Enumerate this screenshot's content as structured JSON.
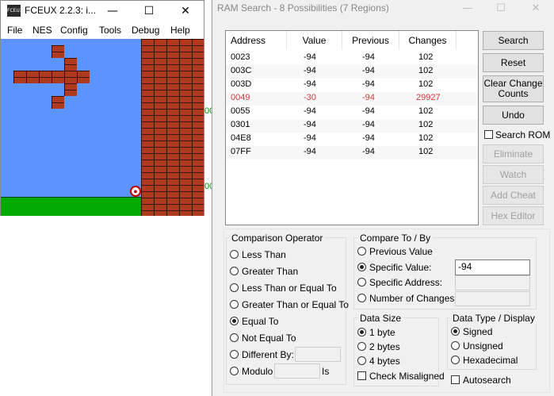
{
  "fceux": {
    "title": "FCEUX 2.2.3: i...",
    "app_icon_text": "FCEUX",
    "controls": {
      "minimize": "—",
      "maximize": "☐",
      "close": "✕"
    },
    "menu": [
      "File",
      "NES",
      "Config",
      "Tools",
      "Debug",
      "Help"
    ],
    "overlay_left_values": [
      "00",
      "00"
    ]
  },
  "ram": {
    "title": "RAM Search - 8 Possibilities (7 Regions)",
    "controls": {
      "minimize": "—",
      "maximize": "☐",
      "close": "✕"
    },
    "columns": [
      "Address",
      "Value",
      "Previous",
      "Changes"
    ],
    "rows": [
      {
        "address": "0023",
        "value": "-94",
        "previous": "-94",
        "changes": "102"
      },
      {
        "address": "003C",
        "value": "-94",
        "previous": "-94",
        "changes": "102"
      },
      {
        "address": "003D",
        "value": "-94",
        "previous": "-94",
        "changes": "102"
      },
      {
        "address": "0049",
        "value": "-30",
        "previous": "-94",
        "changes": "29927"
      },
      {
        "address": "0055",
        "value": "-94",
        "previous": "-94",
        "changes": "102"
      },
      {
        "address": "0301",
        "value": "-94",
        "previous": "-94",
        "changes": "102"
      },
      {
        "address": "04E8",
        "value": "-94",
        "previous": "-94",
        "changes": "102"
      },
      {
        "address": "07FF",
        "value": "-94",
        "previous": "-94",
        "changes": "102"
      }
    ],
    "buttons": {
      "search": "Search",
      "reset": "Reset",
      "clear_counts_1": "Clear Change",
      "clear_counts_2": "Counts",
      "undo": "Undo",
      "eliminate": "Eliminate",
      "watch": "Watch",
      "add_cheat": "Add Cheat",
      "hex_editor": "Hex Editor"
    },
    "search_rom_label": "Search ROM",
    "comparison": {
      "title": "Comparison Operator",
      "options": [
        "Less Than",
        "Greater Than",
        "Less Than or Equal To",
        "Greater Than or Equal To",
        "Equal To",
        "Not Equal To",
        "Different By:",
        "Modulo"
      ],
      "selected": "Equal To",
      "modulo_suffix": "Is"
    },
    "compare_to": {
      "title": "Compare To / By",
      "options": [
        "Previous Value",
        "Specific Value:",
        "Specific Address:",
        "Number of Changes:"
      ],
      "selected": "Specific Value:",
      "specific_value": "-94"
    },
    "data_size": {
      "title": "Data Size",
      "options": [
        "1 byte",
        "2 bytes",
        "4 bytes"
      ],
      "selected": "1 byte",
      "check_misaligned": "Check Misaligned"
    },
    "data_type": {
      "title": "Data Type / Display",
      "options": [
        "Signed",
        "Unsigned",
        "Hexadecimal"
      ],
      "selected": "Signed"
    },
    "autosearch": "Autosearch"
  }
}
